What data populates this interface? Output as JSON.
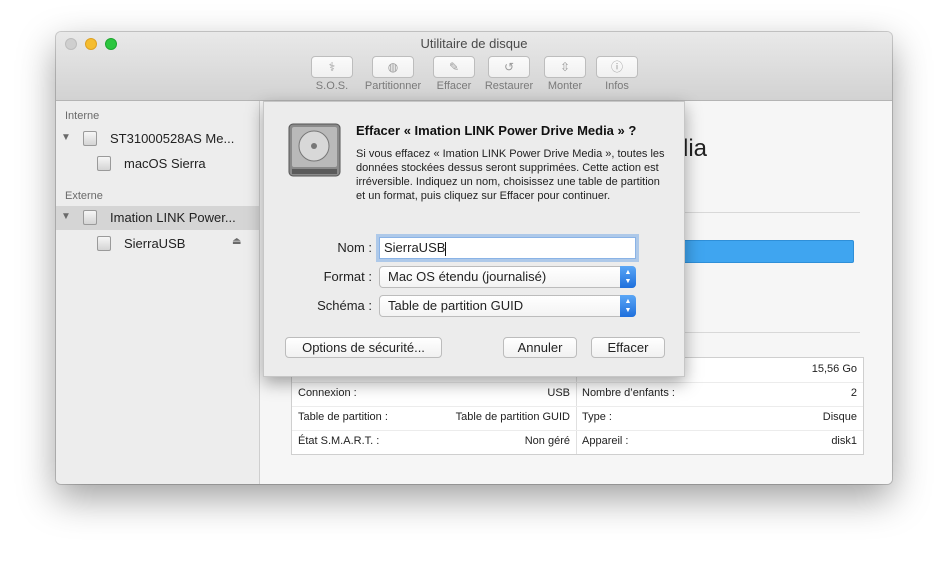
{
  "window": {
    "title": "Utilitaire de disque"
  },
  "toolbar": [
    {
      "label": "S.O.S.",
      "icon": "stethoscope-icon",
      "glyph": "⚕"
    },
    {
      "label": "Partitionner",
      "icon": "partition-icon",
      "glyph": "◍"
    },
    {
      "label": "Effacer",
      "icon": "erase-icon",
      "glyph": "✎"
    },
    {
      "label": "Restaurer",
      "icon": "restore-icon",
      "glyph": "↺"
    },
    {
      "label": "Monter",
      "icon": "mount-icon",
      "glyph": "⇳"
    },
    {
      "label": "Infos",
      "icon": "info-icon",
      "glyph": "ⓘ"
    }
  ],
  "sidebar": {
    "internal_header": "Interne",
    "external_header": "Externe",
    "items": [
      {
        "label": "ST31000528AS Me..."
      },
      {
        "label": "macOS Sierra"
      },
      {
        "label": "Imation LINK Power..."
      },
      {
        "label": "SierraUSB"
      }
    ]
  },
  "main": {
    "disk_name_fragment": "dia",
    "table": [
      {
        "left_key": "",
        "left_value": "",
        "right_key": "",
        "right_value": "15,56 Go"
      },
      {
        "left_key": "Connexion :",
        "left_value": "USB",
        "right_key": "Nombre d’enfants :",
        "right_value": "2"
      },
      {
        "left_key": "Table de partition :",
        "left_value": "Table de partition GUID",
        "right_key": "Type :",
        "right_value": "Disque"
      },
      {
        "left_key": "État S.M.A.R.T. :",
        "left_value": "Non géré",
        "right_key": "Appareil :",
        "right_value": "disk1"
      }
    ]
  },
  "dialog": {
    "title": "Effacer « Imation LINK Power Drive Media » ?",
    "message": "Si vous effacez « Imation LINK Power Drive Media », toutes les données stockées dessus seront supprimées. Cette action est irréversible. Indiquez un nom, choisissez une table de partition et un format, puis cliquez sur Effacer pour continuer.",
    "name_label": "Nom :",
    "name_value": "SierraUSB",
    "format_label": "Format :",
    "format_value": "Mac OS étendu (journalisé)",
    "scheme_label": "Schéma :",
    "scheme_value": "Table de partition GUID",
    "security_button": "Options de sécurité...",
    "cancel_button": "Annuler",
    "erase_button": "Effacer"
  },
  "colors": {
    "accent": "#3fa5f0",
    "popup_arrow": "#1e6fdc"
  }
}
